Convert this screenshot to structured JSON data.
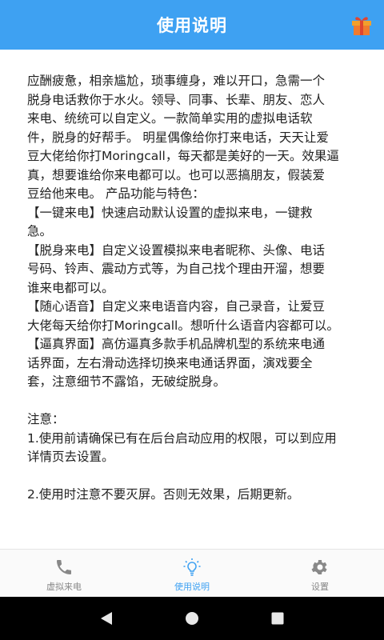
{
  "header": {
    "title": "使用说明",
    "gift_icon": "gift-icon",
    "accent": "#3ea1f2"
  },
  "content": {
    "lines_block1": [
      "应酬疲惫，相亲尴尬，琐事缠身，难以开口，急需一个",
      "脱身电话救你于水火。领导、同事、长辈、朋友、恋人",
      "来电、统统可以自定义。一款简单实用的虚拟电话软",
      "件，脱身的好帮手。 明星偶像给你打来电话，天天让爱",
      "豆大佬给你打Moringcall，每天都是美好的一天。效果逼",
      "真，想要谁给你来电都可以。也可以恶搞朋友，假装爱",
      "豆给他来电。 产品功能与特色：",
      "【一键来电】快速启动默认设置的虚拟来电，一键救",
      "急。",
      "【脱身来电】自定义设置模拟来电者昵称、头像、电话",
      "号码、铃声、震动方式等，为自己找个理由开溜，想要",
      "谁来电都可以。",
      "【随心语音】自定义来电语音内容，自己录音，让爱豆",
      "大佬每天给你打Moringcall。想听什么语音内容都可以。",
      "【逼真界面】高仿逼真多款手机品牌机型的系统来电通",
      "话界面，左右滑动选择切换来电通话界面，演戏要全",
      "套，注意细节不露馅，无破绽脱身。"
    ],
    "lines_block2": [
      "注意：",
      "1.使用前请确保已有在后台启动应用的权限，可以到应用",
      "详情页去设置。"
    ],
    "lines_block3": [
      "2.使用时注意不要灭屏。否则无效果，后期更新。"
    ]
  },
  "bottom_nav": {
    "items": [
      {
        "label": "虚拟来电",
        "icon": "phone-icon"
      },
      {
        "label": "使用说明",
        "icon": "lightbulb-icon"
      },
      {
        "label": "设置",
        "icon": "gear-icon"
      }
    ],
    "active_color": "#3ea1f2",
    "inactive_color": "#888888"
  },
  "system_nav": {
    "back_icon": "back-triangle-icon",
    "home_icon": "home-circle-icon",
    "recents_icon": "recents-square-icon"
  }
}
